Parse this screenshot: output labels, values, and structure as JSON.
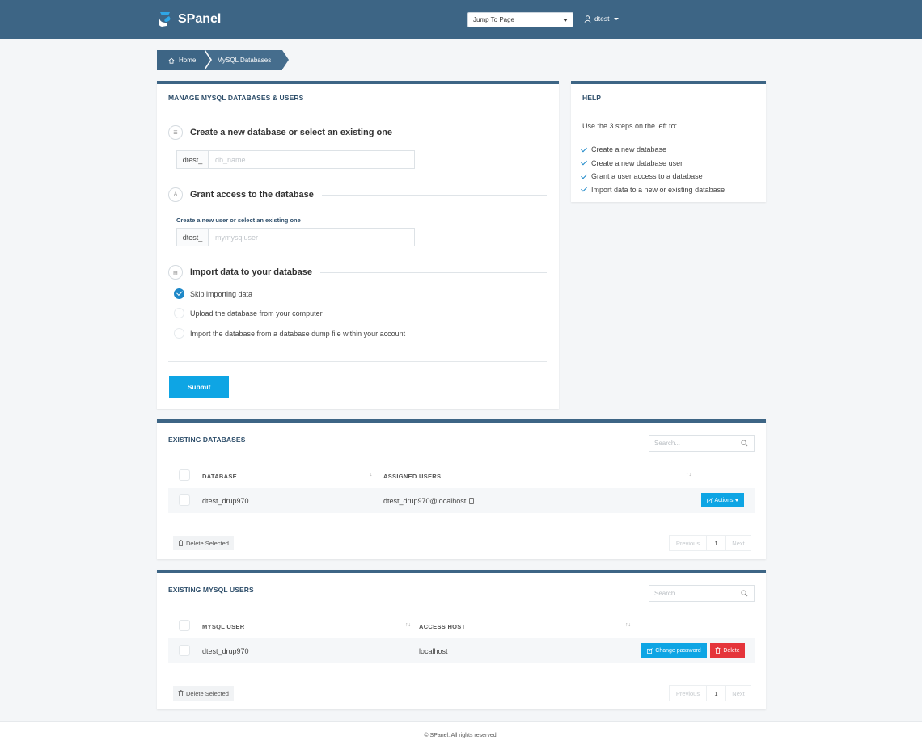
{
  "header": {
    "brand": "SPanel",
    "jump_label": "Jump To Page",
    "username": "dtest"
  },
  "breadcrumb": [
    "Home",
    "MySQL Databases"
  ],
  "manage": {
    "title": "MANAGE MYSQL DATABASES & USERS",
    "step1": {
      "title": "Create a new database or select an existing one",
      "prefix": "dtest_",
      "placeholder": "db_name"
    },
    "step2": {
      "title": "Grant access to the database",
      "sublabel": "Create a new user or select an existing one",
      "prefix": "dtest_",
      "placeholder": "mymysqluser"
    },
    "step3": {
      "title": "Import data to your database"
    },
    "options": [
      {
        "label": "Skip importing data",
        "checked": true
      },
      {
        "label": "Upload the database from your computer",
        "checked": false
      },
      {
        "label": "Import the database from a database dump file within your account",
        "checked": false
      }
    ],
    "submit": "Submit"
  },
  "help": {
    "title": "HELP",
    "intro": "Use the 3 steps on the left to:",
    "items": [
      "Create a new database",
      "Create a new database user",
      "Grant a user access to a database",
      "Import data to a new or existing database"
    ]
  },
  "databases": {
    "title": "EXISTING DATABASES",
    "search_placeholder": "Search...",
    "columns": [
      "DATABASE",
      "ASSIGNED USERS"
    ],
    "rows": [
      {
        "database": "dtest_drup970",
        "users": "dtest_drup970@localhost"
      }
    ],
    "actions_label": "Actions",
    "delete_selected": "Delete Selected",
    "pager": {
      "prev": "Previous",
      "page": "1",
      "next": "Next"
    }
  },
  "users": {
    "title": "EXISTING MYSQL USERS",
    "search_placeholder": "Search...",
    "columns": [
      "MYSQL USER",
      "ACCESS HOST"
    ],
    "rows": [
      {
        "user": "dtest_drup970",
        "host": "localhost"
      }
    ],
    "change_password": "Change password",
    "delete": "Delete",
    "delete_selected": "Delete Selected",
    "pager": {
      "prev": "Previous",
      "page": "1",
      "next": "Next"
    }
  },
  "footer": "© SPanel. All rights reserved.",
  "colors": {
    "header": "#3d6585",
    "accent": "#0ea5e4",
    "danger": "#e5353b"
  }
}
